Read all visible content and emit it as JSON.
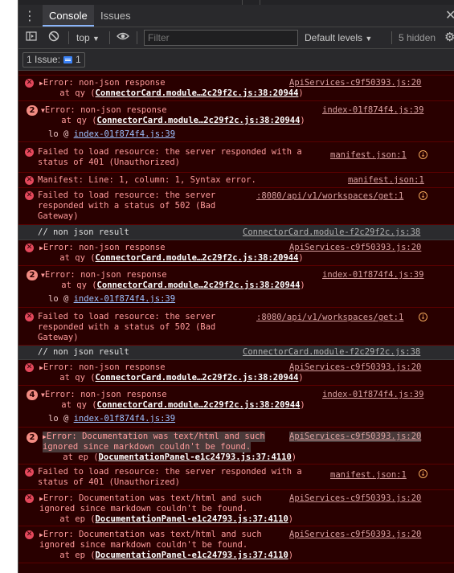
{
  "tabbar": {
    "menu_icon": "kebab-menu-icon",
    "tabs": [
      "Console",
      "Issues"
    ],
    "close_glyph": "✕"
  },
  "toolbar": {
    "context": "top",
    "filter_placeholder": "Filter",
    "levels": "Default levels",
    "hidden": "5 hidden"
  },
  "issues": {
    "label": "1 Issue:",
    "count": "1"
  },
  "log": {
    "m0": {
      "l1": "Error: non-json response",
      "l2": "    at qy (",
      "l2_link": "ConnectorCard.module…2c29f2c.js:38:20944",
      "l2_end": ")",
      "src": "ApiServices-c9f50393.js:20"
    },
    "m1": {
      "count": "2",
      "l1": "Error: non-json response",
      "l2": "    at qy (",
      "l2_link": "ConnectorCard.module…2c29f2c.js:38:20944",
      "l2_end": ")",
      "src": "index-01f874f4.js:39",
      "lo": "lo @ ",
      "lo_link": "index-01f874f4.js:39"
    },
    "m2": {
      "l1": "Failed to load resource: the server responded with a",
      "l2": "status of 401 (Unauthorized)",
      "src": "manifest.json:1"
    },
    "m3": {
      "l1": "Manifest: Line: 1, column: 1, Syntax error.",
      "src": "manifest.json:1"
    },
    "m4": {
      "l1": "Failed to load resource: the server",
      "l2": "responded with a status of 502 (Bad",
      "l3": "Gateway)",
      "src": ":8080/api/v1/workspaces/get:1"
    },
    "m5": {
      "l1": "// non json result",
      "src": "ConnectorCard.module-f2c29f2c.js:38"
    },
    "m6": {
      "l1": "Error: non-json response",
      "l2": "    at qy (",
      "l2_link": "ConnectorCard.module…2c29f2c.js:38:20944",
      "l2_end": ")",
      "src": "ApiServices-c9f50393.js:20"
    },
    "m7": {
      "count": "2",
      "l1": "Error: non-json response",
      "l2": "    at qy (",
      "l2_link": "ConnectorCard.module…2c29f2c.js:38:20944",
      "l2_end": ")",
      "src": "index-01f874f4.js:39",
      "lo": "lo @ ",
      "lo_link": "index-01f874f4.js:39"
    },
    "m8": {
      "l1": "Failed to load resource: the server",
      "l2": "responded with a status of 502 (Bad",
      "l3": "Gateway)",
      "src": ":8080/api/v1/workspaces/get:1"
    },
    "m9": {
      "l1": "// non json result",
      "src": "ConnectorCard.module-f2c29f2c.js:38"
    },
    "m10": {
      "l1": "Error: non-json response",
      "l2": "    at qy (",
      "l2_link": "ConnectorCard.module…2c29f2c.js:38:20944",
      "l2_end": ")",
      "src": "ApiServices-c9f50393.js:20"
    },
    "m11": {
      "count": "4",
      "l1": "Error: non-json response",
      "l2": "    at qy (",
      "l2_link": "ConnectorCard.module…2c29f2c.js:38:20944",
      "l2_end": ")",
      "src": "index-01f874f4.js:39",
      "lo": "lo @ ",
      "lo_link": "index-01f874f4.js:39"
    },
    "m12": {
      "count": "2",
      "l1": "Error: Documentation was text/html and such",
      "l2": "ignored since markdown couldn't be found.",
      "l3": "    at ep (",
      "l3_link": "DocumentationPanel-e1c24793.js:37:4110",
      "l3_end": ")",
      "src": "ApiServices-c9f50393.js:20"
    },
    "m13": {
      "l1": "Failed to load resource: the server responded with a",
      "l2": "status of 401 (Unauthorized)",
      "src": "manifest.json:1"
    },
    "m14": {
      "l1": "Error: Documentation was text/html and such",
      "l2": "ignored since markdown couldn't be found.",
      "l3": "    at ep (",
      "l3_link": "DocumentationPanel-e1c24793.js:37:4110",
      "l3_end": ")",
      "src": "ApiServices-c9f50393.js:20"
    },
    "m15": {
      "l1": "Error: Documentation was text/html and such",
      "l2": "ignored since markdown couldn't be found.",
      "l3": "    at ep (",
      "l3_link": "DocumentationPanel-e1c24793.js:37:4110",
      "l3_end": ")",
      "src": "ApiServices-c9f50393.js:20"
    }
  },
  "colors": {
    "error_bg": "#290000",
    "error_text": "#ff9b9b",
    "accent": "#8ab4f8"
  }
}
